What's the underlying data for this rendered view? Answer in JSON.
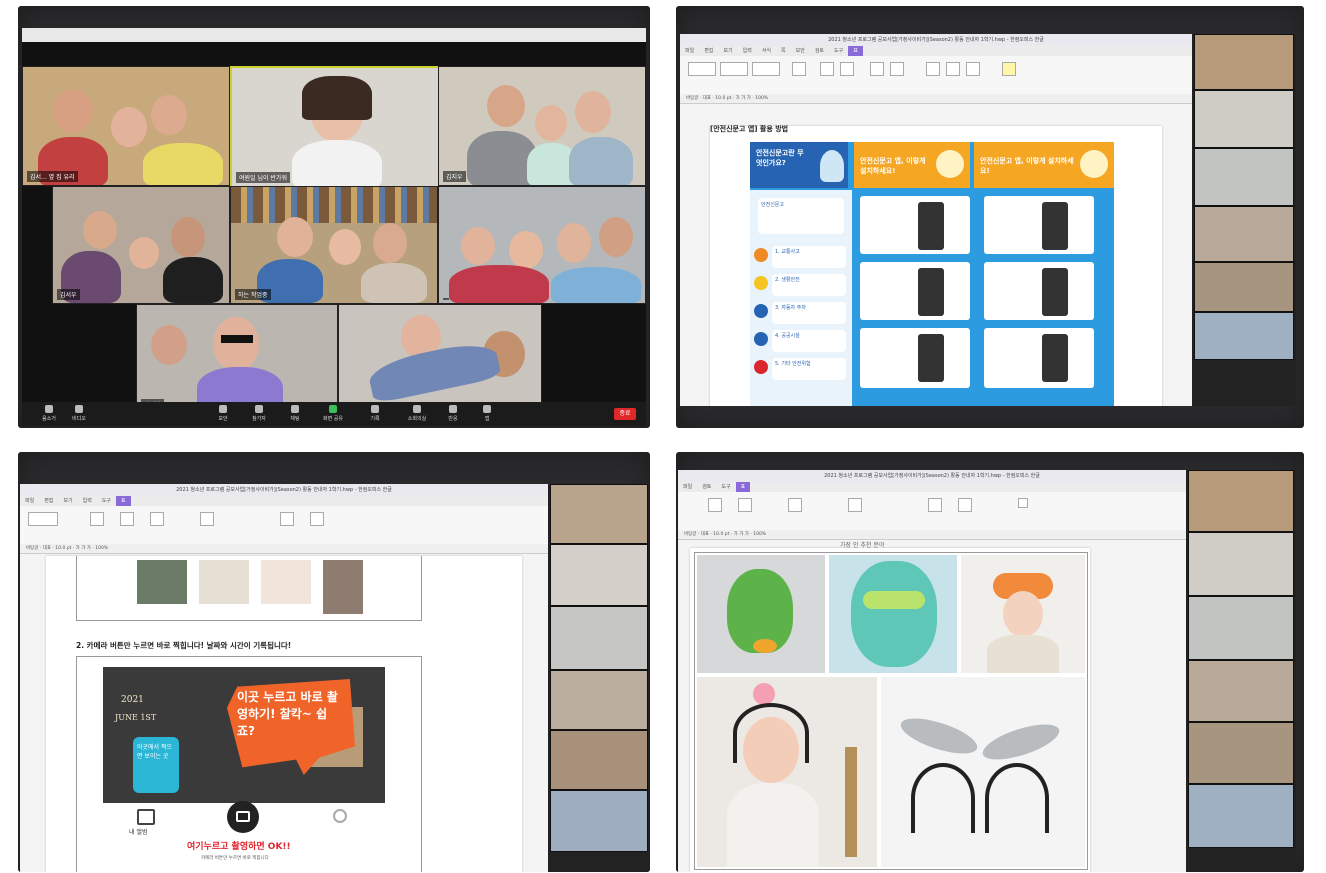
{
  "zoom": {
    "names": [
      "김서... 옆 집 유리",
      "여원일 님이 반가워",
      "김지우",
      "김서우",
      "하는 작업중",
      "",
      "정지현",
      ""
    ],
    "end_label": "종료",
    "toolbar": [
      "음소거",
      "비디오",
      "보안",
      "참가자",
      "채팅",
      "화면 공유",
      "기록",
      "소회의실",
      "반응",
      "앱"
    ]
  },
  "hwp_top": {
    "title": "2021 청소년 프로그램 공모사업[가정사이비가](Season2) 활동 안내자 1학기.hwp - 한컴오피스 한글",
    "menu": [
      "파일",
      "편집",
      "보기",
      "입력",
      "서식",
      "쪽",
      "보안",
      "검토",
      "도구",
      "표"
    ],
    "active_menu": "표",
    "heading": "[안전신문고 앱] 활용 방법",
    "poster": {
      "q": "안전신문고란 무엇인가요?",
      "install1": "안전신문고 앱, 이렇게 설치하세요!",
      "install2": "안전신문고 앱, 이렇게 설치하세요!",
      "brand": "안전신문고",
      "steps": [
        "1. 교통사고",
        "2. 생활안전",
        "3. 자동차 주차",
        "4. 공공시설",
        "5. 기타 안전위험"
      ]
    }
  },
  "hwp_bl": {
    "title": "2021 청소년 프로그램 공모사업[가정사이비가](Season2) 활동 안내자 1학기.hwp - 한컴오피스 한글",
    "heading": "2. 카메라 버튼만 누르면 바로 찍힙니다! 날짜와 시간이 기록됩니다!",
    "bubble_orange": "이곳 누르고 바로 촬영하기! 찰칵~ 쉽죠?",
    "bubble_blue": "이곳에서 찍으면 보이는 곳",
    "photo_date_1": "2021",
    "photo_date_2": "JUNE 1ST",
    "album_label": "내 앨범",
    "ok_label": "여기누르고 촬영하면 OK!!",
    "small_note": "카메라 버튼만 누르면 바로 찍힙니다"
  },
  "hwp_br": {
    "title": "2021 청소년 프로그램 공모사업[가정사이비가](Season2) 활동 안내자 1학기.hwp - 한컴오피스 한글",
    "caption": "가장 인 추천 분야"
  }
}
